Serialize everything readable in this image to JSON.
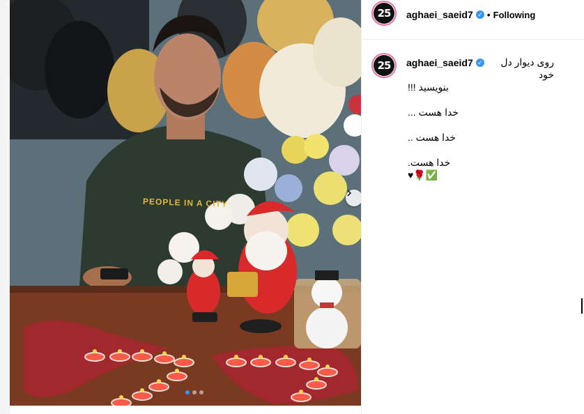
{
  "post": {
    "username": "aghaei_saeid7",
    "avatar_text": "25",
    "follow_separator": "•",
    "follow_status": "Following",
    "verified_icon": "verified-badge-icon",
    "photo_sweatshirt_text": "PEOPLE IN A CITY",
    "carousel": {
      "total": 3,
      "active_index": 1,
      "next_icon": "chevron-right-icon"
    },
    "caption_lines": [
      "روی دیوار دل خود",
      "بنویسید !!!",
      "... خدا هست",
      ".. خدا هست",
      ".خدا هست"
    ],
    "caption_emoji": "♥🌹✅"
  },
  "colors": {
    "verified": "#3797f0",
    "story_ring": "#ea6fa7",
    "divider": "#efefef"
  }
}
